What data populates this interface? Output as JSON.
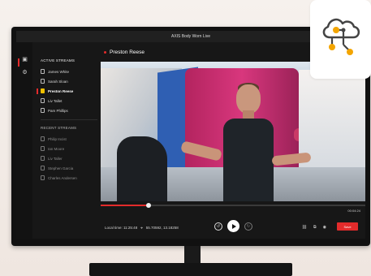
{
  "app": {
    "title": "AXIS Body Worn Live"
  },
  "sidebar": {
    "active_title": "ACTIVE STREAMS",
    "active_streams": [
      {
        "label": "James White"
      },
      {
        "label": "Sarah Sloan"
      },
      {
        "label": "Preston Reese",
        "selected": true
      },
      {
        "label": "Liv Tallet"
      },
      {
        "label": "Pam Phillips"
      }
    ],
    "recent_title": "RECENT STREAMS",
    "recent_streams": [
      {
        "label": "Philip Incist"
      },
      {
        "label": "Ian Moore"
      },
      {
        "label": "Liv Taller"
      },
      {
        "label": "Stephen Garcia"
      },
      {
        "label": "Charles Andersen"
      }
    ]
  },
  "main": {
    "stream_title": "Preston Reese",
    "duration": "00:04:24",
    "local_time": "Local time: 11:25:48",
    "coordinates": "55.70592, 13.18258",
    "progress": 0.18,
    "save_label": "Save"
  },
  "icons": {
    "rail_camera": "camera-icon",
    "rail_settings": "settings-icon",
    "location": "pin-icon",
    "rewind": "rewind-icon",
    "forward": "forward-icon",
    "play": "play-icon",
    "link": "link-icon",
    "copy": "copy-icon",
    "visibility": "eye-icon",
    "cloud": "cloud-network-icon"
  },
  "colors": {
    "accent": "#e32b2b",
    "selected_icon": "#f0c000",
    "cloud_icon": "#f3a500"
  }
}
